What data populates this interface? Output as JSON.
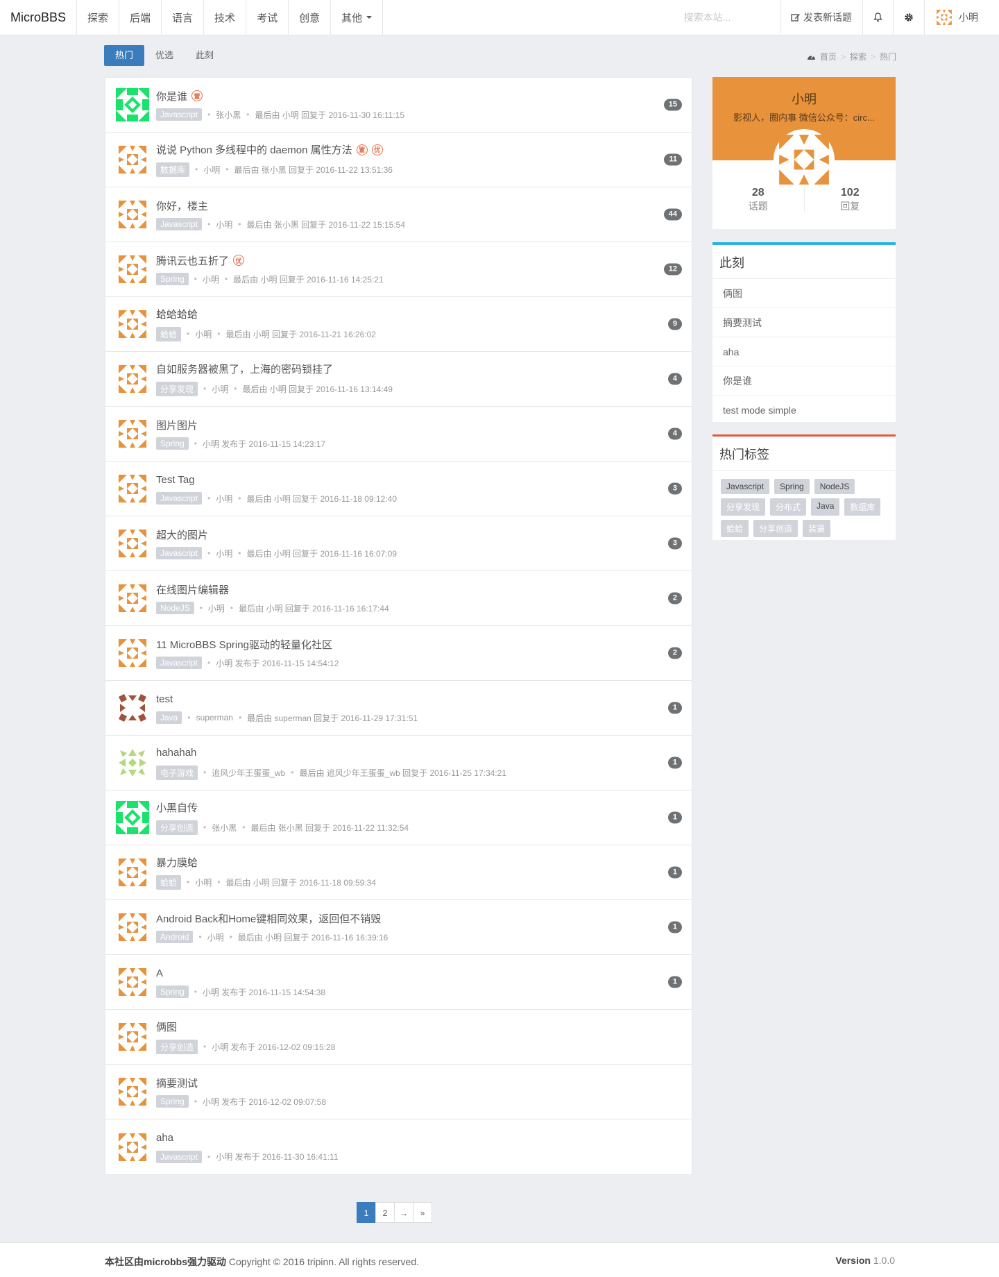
{
  "brand": "MicroBBS",
  "nav": {
    "items": [
      "探索",
      "后端",
      "语言",
      "技术",
      "考试",
      "创意"
    ],
    "more": "其他",
    "search_placeholder": "搜索本站...",
    "new_topic": "发表新话题",
    "username": "小明"
  },
  "tabs": [
    "热门",
    "优选",
    "此刻"
  ],
  "breadcrumb": [
    "首页",
    "探索",
    "热门"
  ],
  "topics": [
    {
      "title": "你是谁",
      "badges": [
        "置"
      ],
      "tag": "Javascript",
      "author": "张小黑",
      "meta": "最后由 小明 回复于 2016-11-30 16:11:15",
      "count": "15",
      "avatar": "green"
    },
    {
      "title": "说说 Python 多线程中的 daemon 属性方法",
      "badges": [
        "置",
        "优"
      ],
      "tag": "数据库",
      "author": "小明",
      "meta": "最后由 张小黑 回复于 2016-11-22 13:51:36",
      "count": "11",
      "avatar": "orange"
    },
    {
      "title": "你好，楼主",
      "badges": [],
      "tag": "Javascript",
      "author": "小明",
      "meta": "最后由 张小黑 回复于 2016-11-22 15:15:54",
      "count": "44",
      "avatar": "orange"
    },
    {
      "title": "腾讯云也五折了",
      "badges": [
        "优"
      ],
      "tag": "Spring",
      "author": "小明",
      "meta": "最后由 小明 回复于 2016-11-16 14:25:21",
      "count": "12",
      "avatar": "orange"
    },
    {
      "title": "蛤蛤蛤蛤",
      "badges": [],
      "tag": "蛤蛤",
      "author": "小明",
      "meta": "最后由 小明 回复于 2016-11-21 16:26:02",
      "count": "9",
      "avatar": "orange"
    },
    {
      "title": "自如服务器被黑了，上海的密码锁挂了",
      "badges": [],
      "tag": "分享发现",
      "author": "小明",
      "meta": "最后由 小明 回复于 2016-11-16 13:14:49",
      "count": "4",
      "avatar": "orange"
    },
    {
      "title": "图片图片",
      "badges": [],
      "tag": "Spring",
      "author": "",
      "meta": "小明 发布于 2016-11-15 14:23:17",
      "count": "4",
      "avatar": "orange"
    },
    {
      "title": "Test Tag",
      "badges": [],
      "tag": "Javascript",
      "author": "小明",
      "meta": "最后由 小明 回复于 2016-11-18 09:12:40",
      "count": "3",
      "avatar": "orange"
    },
    {
      "title": "超大的图片",
      "badges": [],
      "tag": "Javascript",
      "author": "小明",
      "meta": "最后由 小明 回复于 2016-11-16 16:07:09",
      "count": "3",
      "avatar": "orange"
    },
    {
      "title": "在线图片编辑器",
      "badges": [],
      "tag": "NodeJS",
      "author": "小明",
      "meta": "最后由 小明 回复于 2016-11-16 16:17:44",
      "count": "2",
      "avatar": "orange"
    },
    {
      "title": "11 MicroBBS Spring驱动的轻量化社区",
      "badges": [],
      "tag": "Javascript",
      "author": "",
      "meta": "小明 发布于 2016-11-15 14:54:12",
      "count": "2",
      "avatar": "orange"
    },
    {
      "title": "test",
      "badges": [],
      "tag": "Java",
      "author": "superman",
      "meta": "最后由 superman 回复于 2016-11-29 17:31:51",
      "count": "1",
      "avatar": "brown"
    },
    {
      "title": "hahahah",
      "badges": [],
      "tag": "电子游戏",
      "author": "追风少年王蛋蛋_wb",
      "meta": "最后由 追风少年王蛋蛋_wb 回复于 2016-11-25 17:34:21",
      "count": "1",
      "avatar": "lime"
    },
    {
      "title": "小黑自传",
      "badges": [],
      "tag": "分享创造",
      "author": "张小黑",
      "meta": "最后由 张小黑 回复于 2016-11-22 11:32:54",
      "count": "1",
      "avatar": "green"
    },
    {
      "title": "暴力膜蛤",
      "badges": [],
      "tag": "蛤蛤",
      "author": "小明",
      "meta": "最后由 小明 回复于 2016-11-18 09:59:34",
      "count": "1",
      "avatar": "orange"
    },
    {
      "title": "Android Back和Home键相同效果，返回但不销毁",
      "badges": [],
      "tag": "Android",
      "author": "小明",
      "meta": "最后由 小明 回复于 2016-11-16 16:39:16",
      "count": "1",
      "avatar": "orange"
    },
    {
      "title": "A",
      "badges": [],
      "tag": "Spring",
      "author": "",
      "meta": "小明 发布于 2016-11-15 14:54:38",
      "count": "1",
      "avatar": "orange"
    },
    {
      "title": "俩图",
      "badges": [],
      "tag": "分享创造",
      "author": "",
      "meta": "小明 发布于 2016-12-02 09:15:28",
      "count": "",
      "avatar": "orange"
    },
    {
      "title": "摘要测试",
      "badges": [],
      "tag": "Spring",
      "author": "",
      "meta": "小明 发布于 2016-12-02 09:07:58",
      "count": "",
      "avatar": "orange"
    },
    {
      "title": "aha",
      "badges": [],
      "tag": "Javascript",
      "author": "",
      "meta": "小明 发布于 2016-11-30 16:41:11",
      "count": "",
      "avatar": "orange"
    }
  ],
  "profile": {
    "name": "小明",
    "bio": "影视人，圈内事 微信公众号：circ...",
    "topics_num": "28",
    "topics_label": "话题",
    "replies_num": "102",
    "replies_label": "回复"
  },
  "now_panel": {
    "title": "此刻",
    "items": [
      "俩图",
      "摘要测试",
      "aha",
      "你是谁",
      "test mode simple"
    ]
  },
  "tags_panel": {
    "title": "热门标签",
    "tags": [
      {
        "name": "Javascript",
        "dark": true
      },
      {
        "name": "Spring",
        "dark": true
      },
      {
        "name": "NodeJS",
        "dark": true
      },
      {
        "name": "分享发现",
        "dark": false
      },
      {
        "name": "分布式",
        "dark": false
      },
      {
        "name": "Java",
        "dark": true
      },
      {
        "name": "数据库",
        "dark": false
      },
      {
        "name": "蛤蛤",
        "dark": false
      },
      {
        "name": "分享创造",
        "dark": false
      },
      {
        "name": "装逼",
        "dark": false
      }
    ]
  },
  "pagination": [
    "1",
    "2",
    "→",
    "»"
  ],
  "footer": {
    "powered": "本社区由microbbs强力驱动",
    "copyright": "Copyright © 2016 tripinn. All rights reserved.",
    "version_label": "Version",
    "version": "1.0.0"
  },
  "colors": {
    "primary": "#3b7cbd",
    "avatar_orange": "#e8923b",
    "avatar_green": "#19e36b",
    "avatar_brown": "#a0523c",
    "avatar_lime": "#b6d77e",
    "badge_red": "#e8704a",
    "panel_blue": "#2bb3e0",
    "panel_red": "#e05a3c"
  },
  "icons": {
    "new_topic": "edit-icon",
    "notify": "bell-icon",
    "settings": "gear-icon",
    "dashboard": "dashboard-icon"
  }
}
